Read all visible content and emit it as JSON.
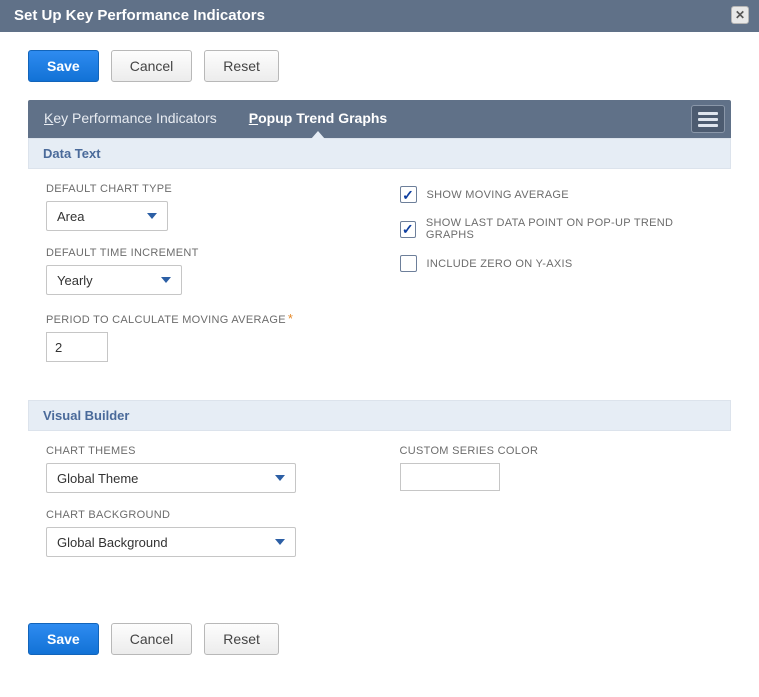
{
  "header": {
    "title": "Set Up Key Performance Indicators"
  },
  "buttons": {
    "save": "Save",
    "cancel": "Cancel",
    "reset": "Reset"
  },
  "tabs": {
    "kpi_rest": "ey Performance Indicators",
    "popup_rest": "opup Trend Graphs"
  },
  "sections": {
    "data_text": "Data Text",
    "visual_builder": "Visual Builder"
  },
  "labels": {
    "default_chart_type": "DEFAULT CHART TYPE",
    "default_time_increment": "DEFAULT TIME INCREMENT",
    "period_moving_avg": "PERIOD TO CALCULATE MOVING AVERAGE",
    "show_moving_average": "SHOW MOVING AVERAGE",
    "show_last_data_point": "SHOW LAST DATA POINT ON POP-UP TREND GRAPHS",
    "include_zero": "INCLUDE ZERO ON Y-AXIS",
    "chart_themes": "CHART THEMES",
    "chart_background": "CHART BACKGROUND",
    "custom_series_color": "CUSTOM SERIES COLOR"
  },
  "values": {
    "default_chart_type": "Area",
    "default_time_increment": "Yearly",
    "period_moving_avg": "2",
    "chart_themes": "Global Theme",
    "chart_background": "Global Background",
    "custom_series_color": ""
  },
  "checks": {
    "show_moving_average": "✓",
    "show_last_data_point": "✓",
    "include_zero": ""
  }
}
